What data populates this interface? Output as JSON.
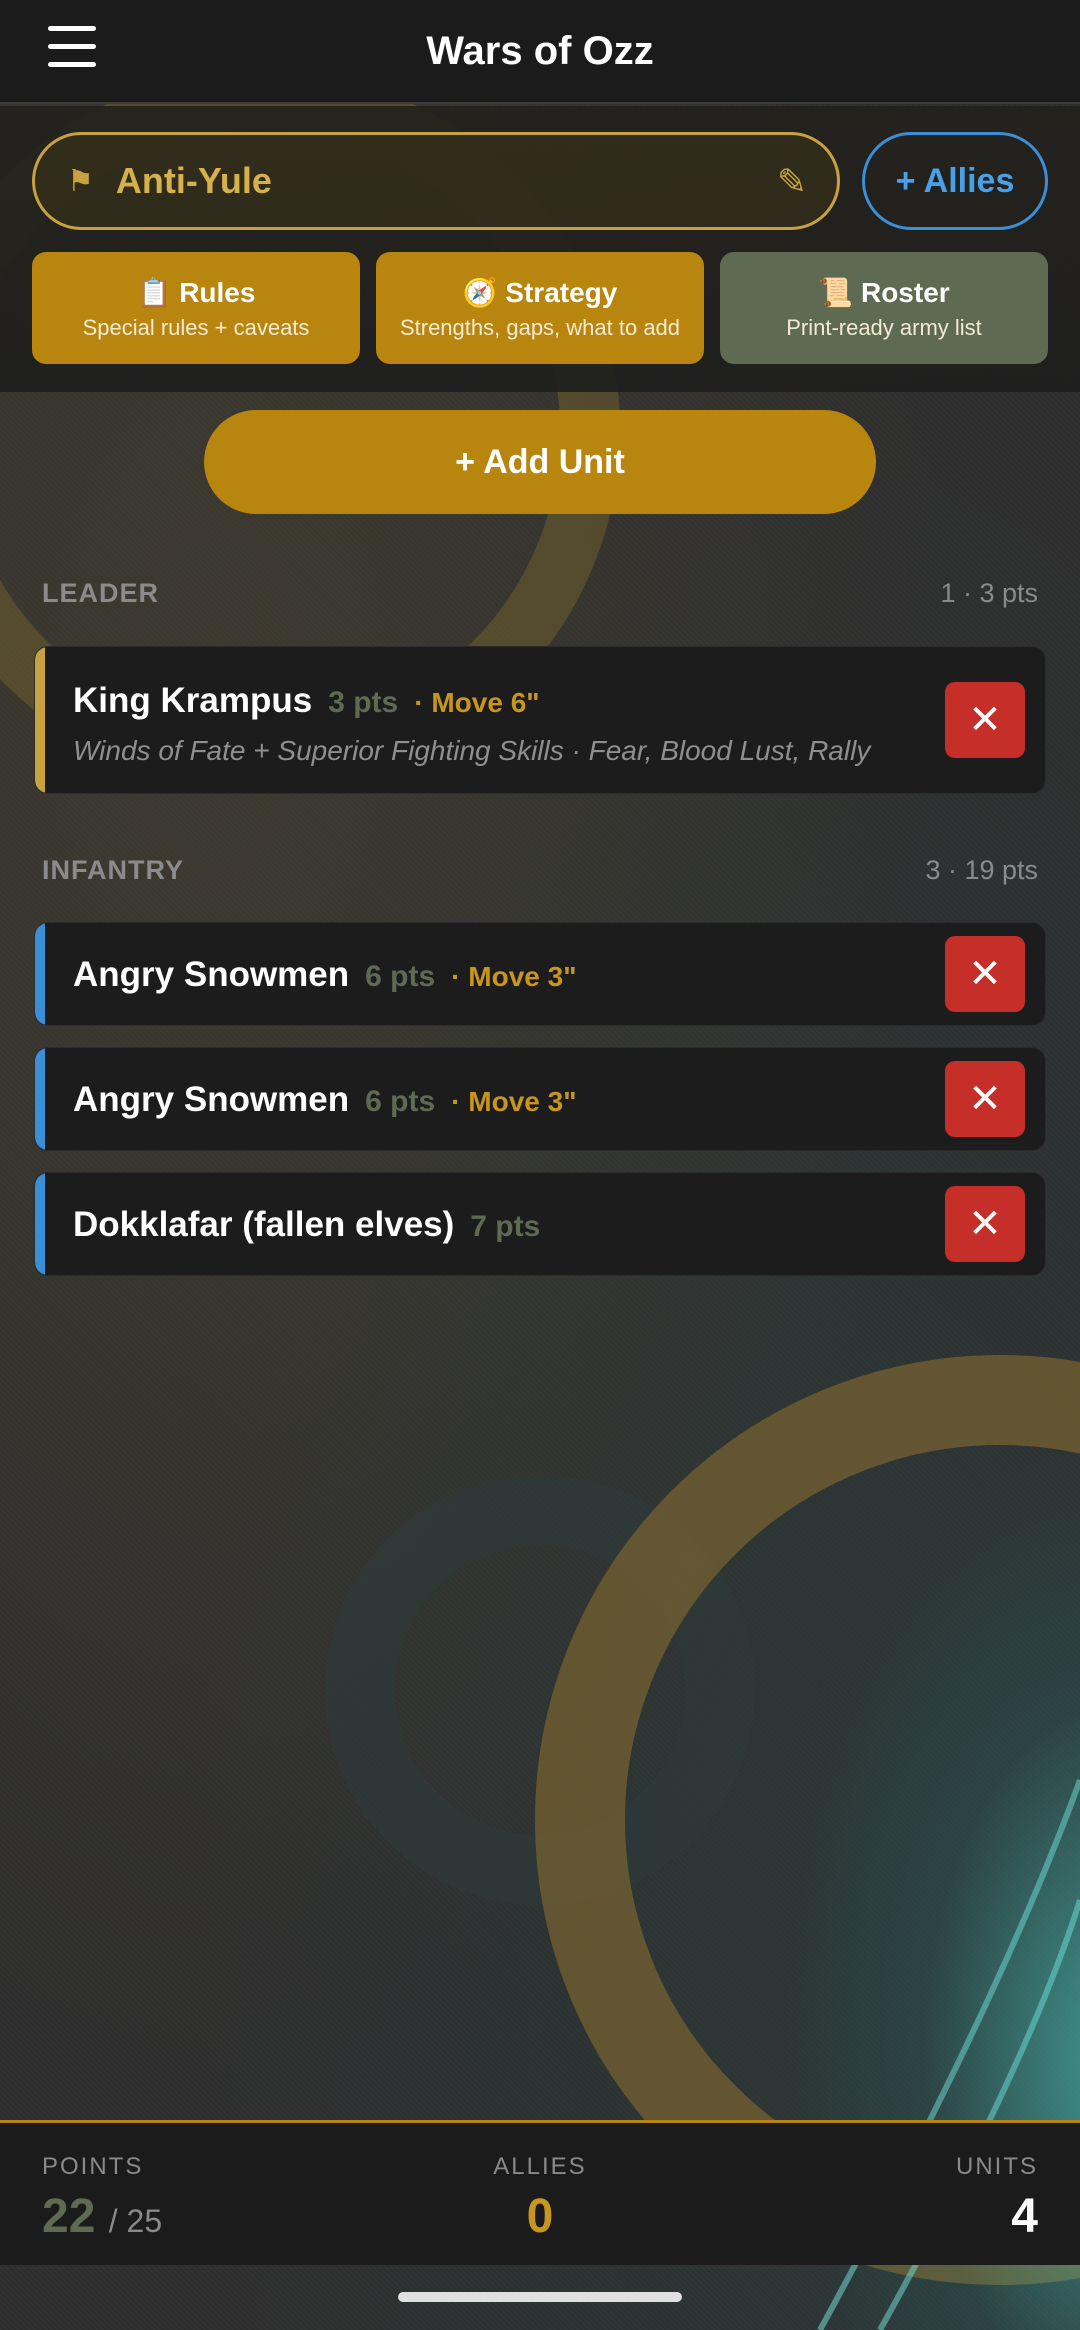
{
  "app": {
    "title": "Wars of Ozz"
  },
  "army": {
    "name": "Anti-Yule",
    "allies_label": "+ Allies"
  },
  "cards": [
    {
      "icon": "📋",
      "title": "Rules",
      "subtitle": "Special rules + caveats"
    },
    {
      "icon": "🧭",
      "title": "Strategy",
      "subtitle": "Strengths, gaps, what to add"
    },
    {
      "icon": "📜",
      "title": "Roster",
      "subtitle": "Print-ready army list"
    }
  ],
  "add_unit_label": "+ Add Unit",
  "sections": [
    {
      "label": "LEADER",
      "count": "1 · 3 pts",
      "units": [
        {
          "name": "King Krampus",
          "pts": "3 pts",
          "move": "· Move 6\"",
          "desc": "Winds of Fate + Superior Fighting Skills · Fear, Blood Lust, Rally"
        }
      ]
    },
    {
      "label": "INFANTRY",
      "count": "3 · 19 pts",
      "units": [
        {
          "name": "Angry Snowmen",
          "pts": "6 pts",
          "move": "· Move 3\""
        },
        {
          "name": "Angry Snowmen",
          "pts": "6 pts",
          "move": "· Move 3\""
        },
        {
          "name": "Dokklafar (fallen elves)",
          "pts": "7 pts"
        }
      ]
    }
  ],
  "footer": {
    "points_label": "POINTS",
    "points_value": "22",
    "points_max": "/ 25",
    "allies_label": "ALLIES",
    "allies_value": "0",
    "units_label": "UNITS",
    "units_value": "4"
  },
  "colors": {
    "gold": "#b8860f",
    "sage": "#5e6b52",
    "leader_stripe": "#c7a23e",
    "infantry_stripe": "#3b8fd6",
    "delete": "#c62e2a"
  },
  "icons": {
    "menu": "hamburger-menu-icon",
    "flag": "flag-icon",
    "edit": "pencil-icon",
    "delete": "close-icon"
  }
}
